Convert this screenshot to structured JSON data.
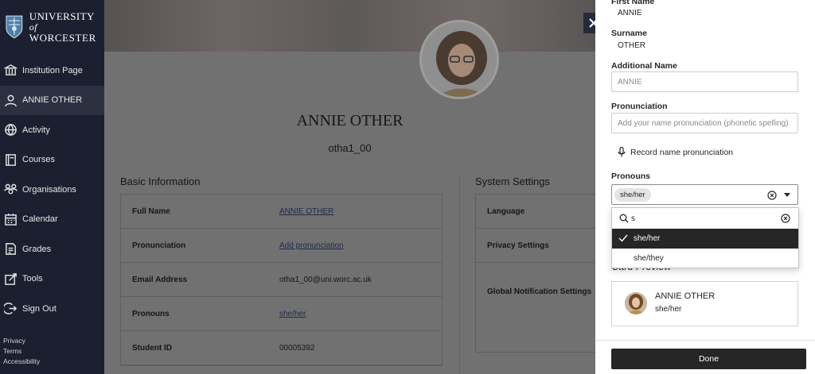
{
  "sidebar": {
    "logo": {
      "line1": "UNIVERSITY",
      "line1_suffix": "of",
      "line2": "WORCESTER"
    },
    "items": [
      {
        "label": "Institution Page",
        "icon": "institution-icon"
      },
      {
        "label": "ANNIE OTHER",
        "icon": "user-icon"
      },
      {
        "label": "Activity",
        "icon": "globe-icon"
      },
      {
        "label": "Courses",
        "icon": "courses-icon"
      },
      {
        "label": "Organisations",
        "icon": "organisations-icon"
      },
      {
        "label": "Calendar",
        "icon": "calendar-icon"
      },
      {
        "label": "Grades",
        "icon": "grades-icon"
      },
      {
        "label": "Tools",
        "icon": "tools-icon"
      },
      {
        "label": "Sign Out",
        "icon": "sign-out-icon"
      }
    ],
    "active_index": 1,
    "legal": [
      "Privacy",
      "Terms",
      "Accessibility"
    ]
  },
  "profile": {
    "name": "ANNIE OTHER",
    "username": "otha1_00",
    "basic_info_title": "Basic Information",
    "system_settings_title": "System Settings",
    "basic_info": [
      {
        "key": "Full Name",
        "value": "ANNIE OTHER",
        "link": true
      },
      {
        "key": "Pronunciation",
        "value": "Add pronunciation",
        "link": true
      },
      {
        "key": "Email Address",
        "value": "otha1_00@uni.worc.ac.uk",
        "link": false
      },
      {
        "key": "Pronouns",
        "value": "she/her",
        "link": true
      },
      {
        "key": "Student ID",
        "value": "00005392",
        "link": false
      }
    ],
    "system_settings": [
      "Language",
      "Privacy Settings",
      "Global Notification Settings"
    ]
  },
  "panel": {
    "first_name_label": "First Name",
    "first_name": "ANNIE",
    "surname_label": "Surname",
    "surname": "OTHER",
    "additional_name_label": "Additional Name",
    "additional_name_placeholder": "ANNIE",
    "pronunciation_label": "Pronunciation",
    "pronunciation_placeholder": "Add your name pronunciation (phonetic spelling)",
    "record_label": "Record name pronunciation",
    "pronouns_label": "Pronouns",
    "pronouns_chip": "she/her",
    "card_preview_title": "Card Preview",
    "card_name": "ANNIE OTHER",
    "card_pronouns": "she/her",
    "done_label": "Done"
  },
  "dropdown": {
    "search_value": "s",
    "options": [
      {
        "label": "she/her",
        "selected": true
      },
      {
        "label": "she/they",
        "selected": false
      }
    ]
  },
  "colors": {
    "sidebar_bg": "#1b2030",
    "dark_button": "#262626",
    "close_button": "#262b3b"
  }
}
